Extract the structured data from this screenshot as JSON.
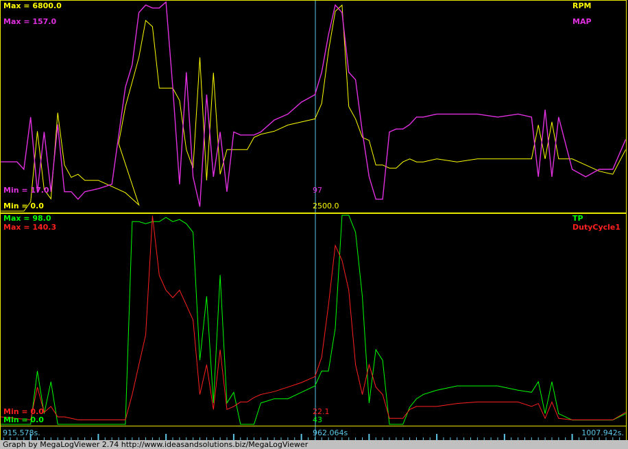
{
  "top_panel": {
    "labels": {
      "rpm_max": "Max = 6800.0",
      "map_max": "Max = 157.0",
      "map_min": "Min = 17.0",
      "rpm_min": "Min = 0.0",
      "rpm_name": "RPM",
      "map_name": "MAP",
      "cursor_map_value": "97",
      "cursor_rpm_value": "2500.0"
    }
  },
  "bottom_panel": {
    "labels": {
      "tp_max": "Max = 98.0",
      "duty_max": "Max = 140.3",
      "duty_min": "Min = 0.0",
      "tp_min": "Min = 0.0",
      "tp_name": "TP",
      "duty_name": "DutyCycle1",
      "cursor_duty_value": "22.1",
      "cursor_tp_value": "43"
    }
  },
  "time_axis": {
    "start": "915.578s.",
    "cursor": "962.064s",
    "end": "1007.942s."
  },
  "footer": "Graph by MegaLogViewer 2.74 http://www.ideasandsolutions.biz/MegaLogViewer",
  "colors": {
    "rpm": "#ffff00",
    "map": "#e030e0",
    "tp": "#00ff00",
    "duty": "#ff2020",
    "cursor": "#5ec8e8",
    "border": "#e8e800"
  },
  "chart_data": [
    {
      "type": "line",
      "x_unit": "s",
      "x_range": [
        915.578,
        1007.942
      ],
      "cursor_x": 962.064,
      "series": [
        {
          "name": "RPM",
          "ylim": [
            0,
            6800
          ],
          "x": [
            915.6,
            917,
            919,
            920,
            921,
            922,
            923,
            924,
            925,
            926,
            927,
            928,
            930,
            932,
            934,
            936,
            933,
            934,
            935,
            936,
            937,
            938,
            939,
            940,
            941,
            942,
            943,
            944,
            945,
            946,
            947,
            948,
            949,
            950,
            951,
            952,
            953,
            954,
            956,
            958,
            960,
            962,
            963,
            964,
            965,
            966,
            967,
            968,
            969,
            970,
            971,
            972,
            973,
            974,
            975,
            976,
            977,
            978,
            980,
            983,
            986,
            989,
            992,
            994,
            995,
            996,
            997,
            998,
            1000,
            1002,
            1004,
            1006,
            1007.9
          ],
          "y": [
            0,
            0,
            0,
            300,
            2600,
            700,
            400,
            3200,
            1500,
            1100,
            1200,
            1000,
            1000,
            800,
            600,
            200,
            2200,
            3400,
            4200,
            5000,
            6200,
            6000,
            4000,
            4000,
            4000,
            3600,
            2000,
            1400,
            5000,
            1000,
            4500,
            1200,
            2000,
            2000,
            2000,
            2000,
            2400,
            2500,
            2600,
            2800,
            2900,
            3000,
            3500,
            5200,
            6500,
            6700,
            3400,
            3000,
            2400,
            2300,
            1500,
            1500,
            1400,
            1400,
            1600,
            1700,
            1600,
            1600,
            1700,
            1600,
            1700,
            1700,
            1700,
            1700,
            2800,
            1700,
            2900,
            1700,
            1700,
            1500,
            1300,
            1200,
            2000
          ]
        },
        {
          "name": "MAP",
          "ylim": [
            17,
            157
          ],
          "x": [
            915.6,
            918,
            919,
            920,
            921,
            922,
            923,
            924,
            925,
            926,
            927,
            928,
            930,
            932,
            934,
            935,
            936,
            937,
            938,
            939,
            940,
            941,
            942,
            943,
            944,
            945,
            946,
            947,
            948,
            949,
            950,
            951,
            952,
            953,
            954,
            956,
            958,
            960,
            962,
            963,
            964,
            965,
            966,
            967,
            968,
            969,
            970,
            971,
            972,
            973,
            974,
            975,
            976,
            977,
            978,
            980,
            983,
            986,
            989,
            992,
            994,
            995,
            996,
            997,
            998,
            1000,
            1002,
            1004,
            1006,
            1007.9
          ],
          "y": [
            50,
            50,
            45,
            80,
            30,
            70,
            30,
            75,
            30,
            30,
            25,
            30,
            32,
            35,
            100,
            115,
            150,
            155,
            153,
            153,
            157,
            100,
            35,
            110,
            40,
            20,
            95,
            40,
            70,
            30,
            70,
            68,
            68,
            68,
            70,
            78,
            82,
            90,
            95,
            110,
            135,
            155,
            150,
            110,
            105,
            70,
            40,
            25,
            25,
            70,
            72,
            72,
            75,
            80,
            80,
            82,
            82,
            82,
            80,
            82,
            80,
            40,
            85,
            40,
            80,
            45,
            40,
            45,
            45,
            65
          ]
        }
      ]
    },
    {
      "type": "line",
      "x_unit": "s",
      "x_range": [
        915.578,
        1007.942
      ],
      "cursor_x": 962.064,
      "series": [
        {
          "name": "TP",
          "ylim": [
            0,
            98
          ],
          "x": [
            915.6,
            920,
            921,
            922,
            923,
            924,
            925,
            926,
            927,
            928,
            930,
            932,
            934,
            935,
            936,
            937,
            938,
            939,
            940,
            941,
            942,
            943,
            944,
            945,
            946,
            947,
            948,
            949,
            950,
            951,
            952,
            953,
            954,
            956,
            958,
            960,
            962,
            963,
            964,
            965,
            966,
            967,
            968,
            969,
            970,
            971,
            972,
            973,
            974,
            975,
            976,
            977,
            978,
            980,
            983,
            986,
            989,
            992,
            994,
            995,
            996,
            997,
            998,
            1000,
            1002,
            1004,
            1006,
            1007.9
          ],
          "y": [
            0,
            0,
            25,
            5,
            20,
            0,
            0,
            0,
            0,
            0,
            0,
            0,
            0,
            95,
            95,
            94,
            95,
            95,
            97,
            95,
            96,
            94,
            90,
            30,
            60,
            10,
            70,
            10,
            15,
            0,
            0,
            0,
            10,
            12,
            12,
            15,
            18,
            25,
            25,
            45,
            98,
            98,
            90,
            60,
            10,
            35,
            30,
            0,
            0,
            0,
            8,
            12,
            14,
            16,
            18,
            18,
            18,
            16,
            15,
            20,
            5,
            20,
            5,
            2,
            2,
            2,
            2,
            5
          ]
        },
        {
          "name": "DutyCycle1",
          "ylim": [
            0,
            140.3
          ],
          "x": [
            915.6,
            920,
            921,
            922,
            923,
            924,
            925,
            926,
            927,
            928,
            930,
            932,
            934,
            935,
            936,
            937,
            938,
            939,
            940,
            941,
            942,
            943,
            944,
            945,
            946,
            947,
            948,
            949,
            950,
            951,
            952,
            953,
            954,
            956,
            958,
            960,
            962,
            963,
            964,
            965,
            966,
            967,
            968,
            969,
            970,
            971,
            972,
            973,
            974,
            975,
            976,
            977,
            978,
            980,
            983,
            986,
            989,
            992,
            994,
            995,
            996,
            997,
            998,
            1000,
            1002,
            1004,
            1006,
            1007.9
          ],
          "y": [
            5,
            3,
            25,
            8,
            12,
            5,
            5,
            4,
            3,
            3,
            3,
            3,
            3,
            20,
            40,
            60,
            140,
            100,
            90,
            85,
            90,
            80,
            70,
            20,
            40,
            10,
            50,
            10,
            12,
            15,
            15,
            18,
            20,
            22,
            25,
            28,
            32,
            45,
            80,
            120,
            110,
            90,
            40,
            20,
            40,
            25,
            20,
            4,
            4,
            4,
            10,
            12,
            12,
            12,
            14,
            15,
            15,
            15,
            12,
            14,
            4,
            15,
            4,
            3,
            3,
            3,
            3,
            8
          ]
        }
      ]
    }
  ]
}
